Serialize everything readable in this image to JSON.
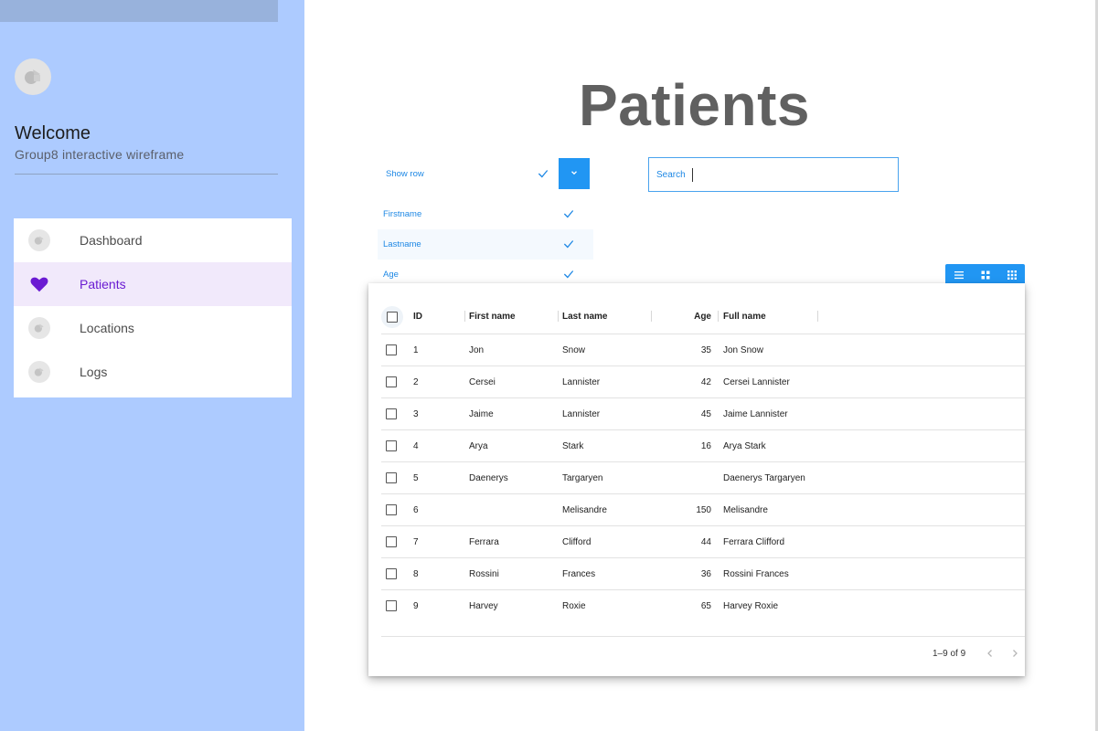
{
  "sidebar": {
    "welcome": "Welcome",
    "subtitle": "Group8 interactive wireframe",
    "items": [
      {
        "label": "Dashboard",
        "icon": "generic-icon",
        "active": false
      },
      {
        "label": "Patients",
        "icon": "heart-icon",
        "active": true
      },
      {
        "label": "Locations",
        "icon": "generic-icon",
        "active": false
      },
      {
        "label": "Logs",
        "icon": "generic-icon",
        "active": false
      }
    ]
  },
  "main": {
    "title": "Patients",
    "show_row": {
      "label": "Show row",
      "options": [
        {
          "label": "Firstname",
          "checked": true
        },
        {
          "label": "Lastname",
          "checked": true
        },
        {
          "label": "Age",
          "checked": true
        }
      ]
    },
    "search": {
      "label": "Search",
      "value": ""
    },
    "view_toggle": [
      "list-view-icon",
      "grid-view-icon",
      "dense-grid-view-icon"
    ],
    "table": {
      "headers": {
        "id": "ID",
        "first_name": "First name",
        "last_name": "Last name",
        "age": "Age",
        "full_name": "Full name"
      },
      "rows": [
        {
          "id": "1",
          "first": "Jon",
          "last": "Snow",
          "age": "35",
          "full": "Jon Snow"
        },
        {
          "id": "2",
          "first": "Cersei",
          "last": "Lannister",
          "age": "42",
          "full": "Cersei Lannister"
        },
        {
          "id": "3",
          "first": "Jaime",
          "last": "Lannister",
          "age": "45",
          "full": "Jaime Lannister"
        },
        {
          "id": "4",
          "first": "Arya",
          "last": "Stark",
          "age": "16",
          "full": "Arya Stark"
        },
        {
          "id": "5",
          "first": "Daenerys",
          "last": "Targaryen",
          "age": "",
          "full": "Daenerys Targaryen"
        },
        {
          "id": "6",
          "first": "",
          "last": "Melisandre",
          "age": "150",
          "full": "Melisandre"
        },
        {
          "id": "7",
          "first": "Ferrara",
          "last": "Clifford",
          "age": "44",
          "full": "Ferrara Clifford"
        },
        {
          "id": "8",
          "first": "Rossini",
          "last": "Frances",
          "age": "36",
          "full": "Rossini Frances"
        },
        {
          "id": "9",
          "first": "Harvey",
          "last": "Roxie",
          "age": "65",
          "full": "Harvey Roxie"
        }
      ],
      "pagination": "1–9 of 9"
    }
  },
  "colors": {
    "sidebar_bg": "#adcbff",
    "accent": "#2196f3",
    "active_purple": "#6a1bd2"
  }
}
